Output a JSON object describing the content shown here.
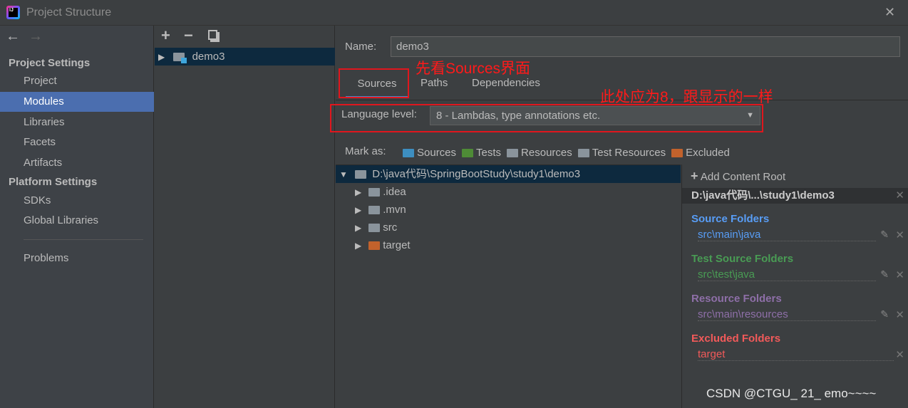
{
  "window": {
    "title": "Project Structure",
    "close": "✕"
  },
  "nav": {
    "back": "←",
    "forward": "→"
  },
  "sidebar": {
    "project_settings": "Project Settings",
    "project_items": [
      {
        "label": "Project"
      },
      {
        "label": "Modules",
        "selected": true
      },
      {
        "label": "Libraries"
      },
      {
        "label": "Facets"
      },
      {
        "label": "Artifacts"
      }
    ],
    "platform_settings": "Platform Settings",
    "platform_items": [
      {
        "label": "SDKs"
      },
      {
        "label": "Global Libraries"
      }
    ],
    "problems": "Problems"
  },
  "modules": {
    "add": "+",
    "remove": "−",
    "items": [
      {
        "label": "demo3"
      }
    ]
  },
  "main": {
    "name_label": "Name:",
    "name_value": "demo3",
    "tabs": [
      {
        "label": "Sources",
        "active": true
      },
      {
        "label": "Paths"
      },
      {
        "label": "Dependencies"
      }
    ],
    "language_label": "Language level:",
    "language_value": "8 - Lambdas, type annotations etc.",
    "mark_as": "Mark as:",
    "mark_buttons": [
      {
        "label": "Sources",
        "color": "#3d8ec0"
      },
      {
        "label": "Tests",
        "color": "#4e8b36"
      },
      {
        "label": "Resources",
        "color": "#8a949c"
      },
      {
        "label": "Test Resources",
        "color": "#8a949c"
      },
      {
        "label": "Excluded",
        "color": "#c2622c"
      }
    ],
    "tree": {
      "root": "D:\\java代码\\SpringBootStudy\\study1\\demo3",
      "children": [
        {
          "label": ".idea",
          "color": "#8a949c"
        },
        {
          "label": ".mvn",
          "color": "#8a949c"
        },
        {
          "label": "src",
          "color": "#8a949c"
        },
        {
          "label": "target",
          "color": "#c2622c"
        }
      ]
    }
  },
  "content_root": {
    "add_label": "Add Content Root",
    "path": "D:\\java代码\\...\\study1\\demo3",
    "groups": [
      {
        "title": "Source Folders",
        "item": "src\\main\\java",
        "color": "#589df6",
        "editable": true
      },
      {
        "title": "Test Source Folders",
        "item": "src\\test\\java",
        "color": "#499c54",
        "editable": true
      },
      {
        "title": "Resource Folders",
        "item": "src\\main\\resources",
        "color": "#8e6fa8",
        "editable": true
      },
      {
        "title": "Excluded Folders",
        "item": "target",
        "color": "#f25a5a",
        "editable": false
      }
    ]
  },
  "annotations": {
    "a1": "先看Sources界面",
    "a2": "此处应为8，跟显示的一样"
  },
  "watermark": "CSDN @CTGU_ 21_  emo~~~~"
}
